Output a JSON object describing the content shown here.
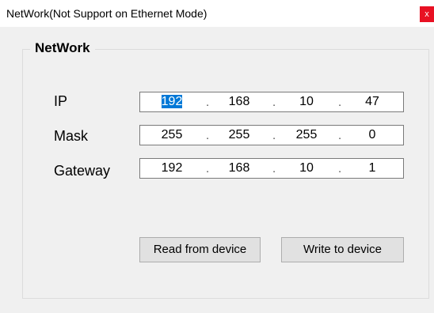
{
  "window": {
    "title": "NetWork(Not Support on Ethernet Mode)",
    "close_glyph": "x"
  },
  "group": {
    "title": "NetWork"
  },
  "fields": {
    "ip": {
      "label": "IP",
      "octets": [
        "192",
        "168",
        "10",
        "47"
      ],
      "selected_octet": 0
    },
    "mask": {
      "label": "Mask",
      "octets": [
        "255",
        "255",
        "255",
        "0"
      ]
    },
    "gateway": {
      "label": "Gateway",
      "octets": [
        "192",
        "168",
        "10",
        "1"
      ]
    },
    "separator": "."
  },
  "buttons": {
    "read": "Read from device",
    "write": "Write to device"
  },
  "colors": {
    "selection": "#0078d7",
    "close": "#e81123"
  }
}
